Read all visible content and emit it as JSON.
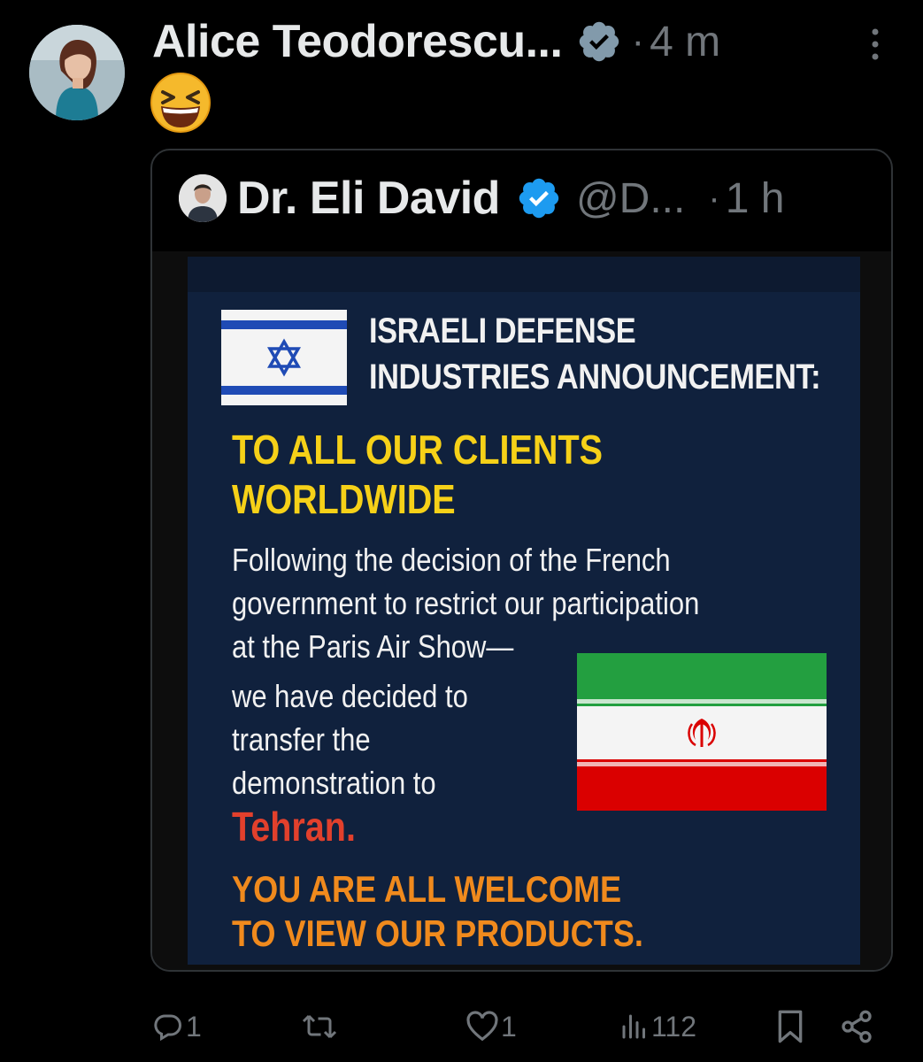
{
  "post": {
    "author_name": "Alice Teodorescu...",
    "separator": "·",
    "time": "4 m",
    "emoji": "😆"
  },
  "quote": {
    "author_name": "Dr. Eli David",
    "handle": "@D...",
    "separator": "·",
    "time": "1 h",
    "image": {
      "title_lines": [
        "ISRAELI DEFENSE",
        "INDUSTRIES ANNOUNCEMENT:"
      ],
      "headline_lines": [
        "TO ALL OUR CLIENTS",
        "WORLDWIDE"
      ],
      "body_lines": [
        "Following the decision of the French",
        "government to restrict our participation",
        "at the Paris Air Show—"
      ],
      "body2_lines": [
        "we have decided to",
        "transfer the",
        "demonstration to"
      ],
      "city": "Tehran.",
      "closing_lines": [
        "YOU ARE ALL WELCOME",
        "TO VIEW OUR PRODUCTS."
      ],
      "colors": {
        "background": "#10213d",
        "headline": "#f6d118",
        "city": "#e2402c",
        "closing": "#f08a1d"
      }
    }
  },
  "actions": {
    "reply_count": "1",
    "repost_count": "",
    "like_count": "1",
    "view_count": "112"
  },
  "icons": {
    "verified": "verified-badge-icon",
    "more": "more-dots-icon",
    "reply": "reply-bubble-icon",
    "repost": "repost-arrows-icon",
    "like": "heart-icon",
    "views": "views-bars-icon",
    "bookmark": "bookmark-icon",
    "share": "share-nodes-icon"
  },
  "theme": {
    "background": "#000000",
    "text": "#e7e9ea",
    "muted": "#71767b",
    "verified": "#1d9bf0",
    "border": "#2f3336"
  }
}
